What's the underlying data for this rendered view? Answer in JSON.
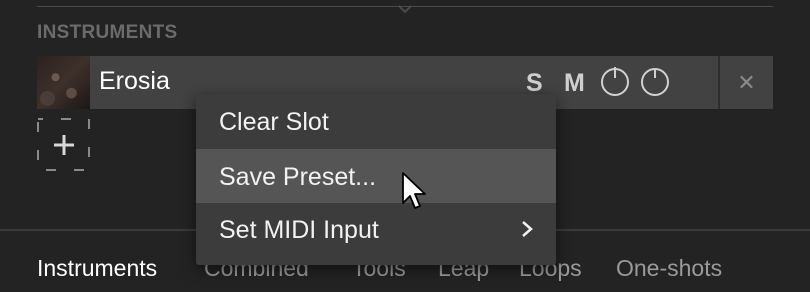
{
  "section": {
    "title": "INSTRUMENTS"
  },
  "slot": {
    "name": "Erosia",
    "solo_label": "S",
    "mute_label": "M",
    "close_icon": "close-icon",
    "knob_icons": [
      "power-knob-icon",
      "knob-icon"
    ]
  },
  "add_slot": {
    "icon": "plus-icon"
  },
  "context_menu": {
    "items": [
      {
        "label": "Clear Slot"
      },
      {
        "label": "Save Preset...",
        "hovered": true
      },
      {
        "label": "Set MIDI Input",
        "submenu": true
      }
    ]
  },
  "tabs": [
    {
      "label": "Instruments",
      "active": true
    },
    {
      "label": "Combined"
    },
    {
      "label": "Tools"
    },
    {
      "label": "Leap"
    },
    {
      "label": "Loops"
    },
    {
      "label": "One-shots"
    }
  ],
  "colors": {
    "background": "#232323",
    "slot": "#424242",
    "menu": "#3c3c3c",
    "menu_hover": "#555555"
  }
}
